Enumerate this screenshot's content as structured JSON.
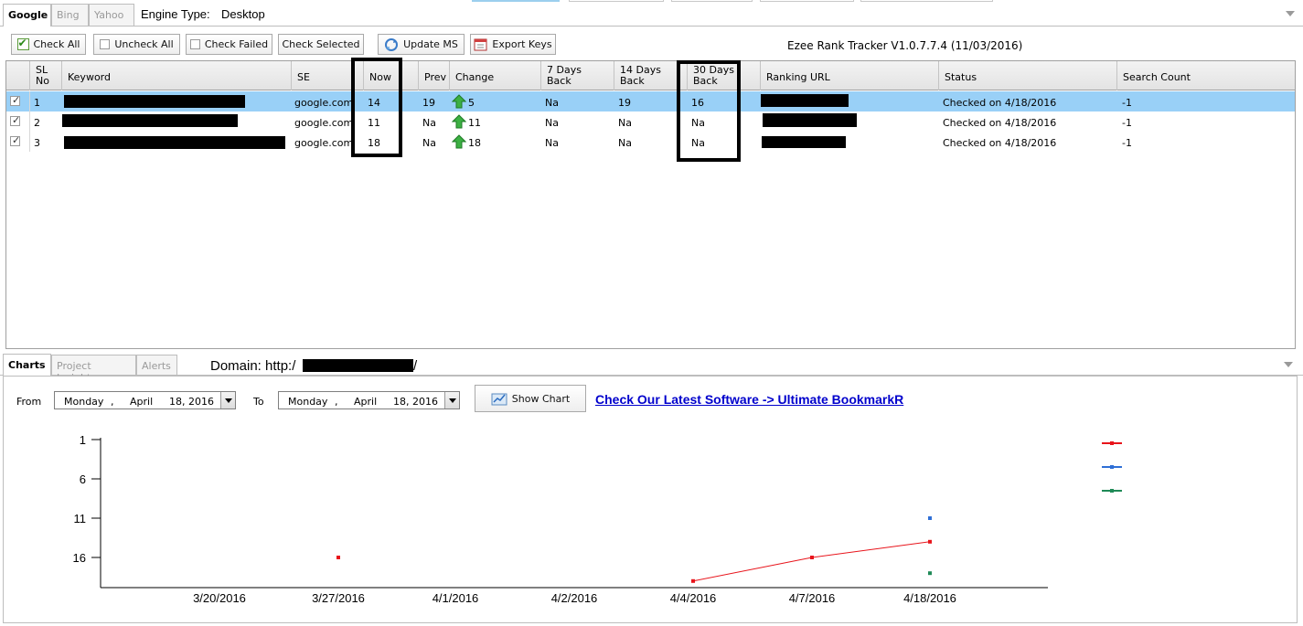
{
  "engine_tabs": [
    "Google",
    "Bing",
    "Yahoo"
  ],
  "engine_type_label": "Engine Type:",
  "engine_type_value": "Desktop",
  "toolbar": {
    "check_all": "Check All",
    "uncheck_all": "Uncheck All",
    "check_failed": "Check Failed",
    "check_selected": "Check Selected",
    "update_ms": "Update MS",
    "export_keys": "Export Keys"
  },
  "version": "Ezee Rank Tracker V1.0.7.7.4 (11/03/2016)",
  "columns": [
    "SL\nNo",
    "Keyword",
    "SE",
    "Now",
    "Prev",
    "Change",
    "7 Days\nBack",
    "14 Days\nBack",
    "30 Days\nBack",
    "Ranking URL",
    "Status",
    "Search Count"
  ],
  "rows": [
    {
      "sl": "1",
      "se": "google.com",
      "now": "14",
      "prev": "19",
      "change": "5",
      "d7": "Na",
      "d14": "19",
      "d30": "16",
      "status": "Checked on 4/18/2016",
      "count": "-1",
      "checked": true,
      "selected": true
    },
    {
      "sl": "2",
      "se": "google.com",
      "now": "11",
      "prev": "Na",
      "change": "11",
      "d7": "Na",
      "d14": "Na",
      "d30": "Na",
      "status": "Checked on 4/18/2016",
      "count": "-1",
      "checked": true,
      "selected": false
    },
    {
      "sl": "3",
      "se": "google.com",
      "now": "18",
      "prev": "Na",
      "change": "18",
      "d7": "Na",
      "d14": "Na",
      "d30": "Na",
      "status": "Checked on 4/18/2016",
      "count": "-1",
      "checked": true,
      "selected": false
    }
  ],
  "bottom_tabs": [
    "Charts",
    "Project Insights",
    "Alerts"
  ],
  "domain_label": "Domain: http:/",
  "domain_suffix": "/",
  "from_label": "From",
  "to_label": "To",
  "from_date": {
    "day": "Monday",
    "sep": ",",
    "month": "April",
    "date": "18, 2016"
  },
  "to_date": {
    "day": "Monday",
    "sep": ",",
    "month": "April",
    "date": "18, 2016"
  },
  "show_chart": "Show Chart",
  "promo_link": "Check Our Latest Software -> Ultimate BookmarkR",
  "colors": {
    "selected_row": "#99d0f7",
    "series_red": "#e8141b",
    "series_blue": "#2f6fd6",
    "series_green": "#1f8a57",
    "link": "#0000cc"
  },
  "chart_data": {
    "type": "line",
    "categories": [
      "3/20/2016",
      "3/27/2016",
      "4/1/2016",
      "4/2/2016",
      "4/4/2016",
      "4/7/2016",
      "4/18/2016"
    ],
    "y_ticks": [
      1,
      6,
      11,
      16
    ],
    "ylim": [
      1,
      20
    ],
    "y_inverted": true,
    "series": [
      {
        "color": "#e8141b",
        "values": [
          null,
          16,
          null,
          null,
          19,
          16,
          14
        ],
        "connect_from": 4
      },
      {
        "color": "#2f6fd6",
        "values": [
          null,
          null,
          null,
          null,
          null,
          null,
          11
        ]
      },
      {
        "color": "#1f8a57",
        "values": [
          null,
          null,
          null,
          null,
          null,
          null,
          18
        ]
      }
    ],
    "legend": "right"
  }
}
